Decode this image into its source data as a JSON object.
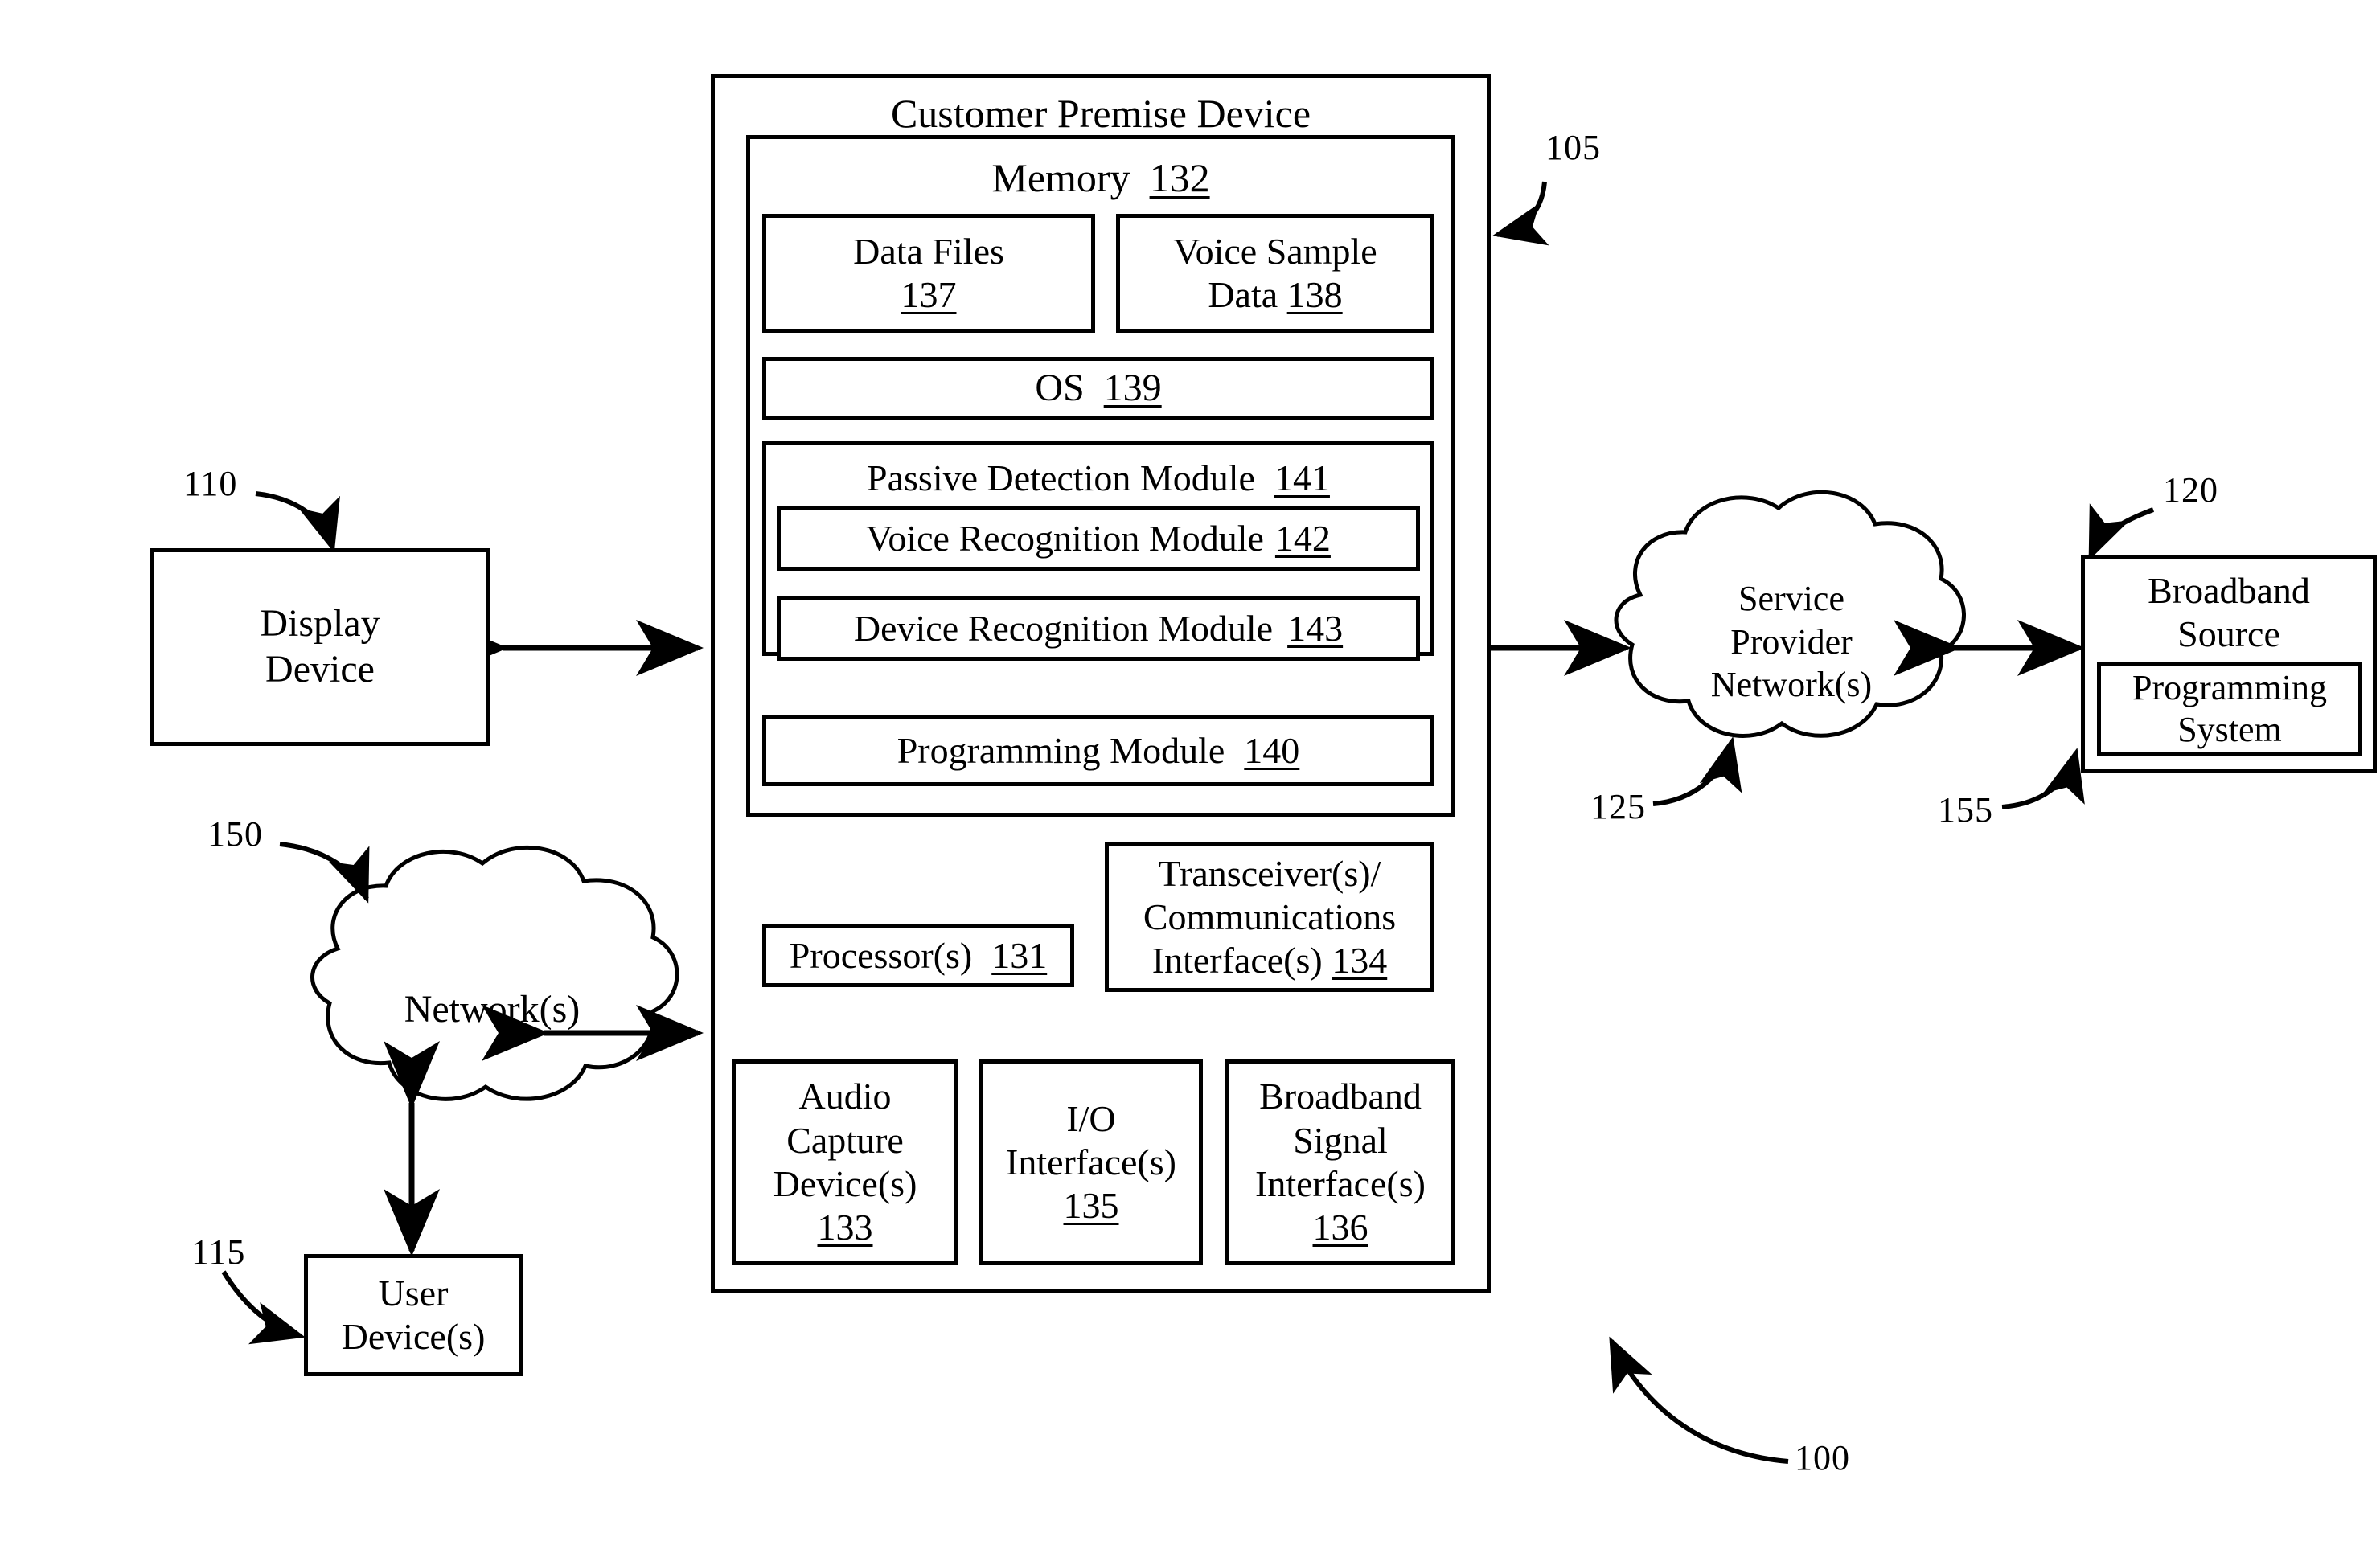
{
  "figure": {
    "system_ref": "100",
    "cpe_ref": "105"
  },
  "cpe": {
    "title": "Customer Premise Device",
    "memory": {
      "label": "Memory",
      "ref": "132",
      "data_files": {
        "label": "Data Files",
        "ref": "137"
      },
      "voice_sample": {
        "label_line1": "Voice Sample",
        "label_line2": "Data",
        "ref": "138"
      },
      "os": {
        "label": "OS",
        "ref": "139"
      },
      "passive_detection": {
        "label": "Passive Detection Module",
        "ref": "141"
      },
      "voice_recognition": {
        "label": "Voice Recognition Module",
        "ref": "142"
      },
      "device_recognition": {
        "label": "Device Recognition Module",
        "ref": "143"
      },
      "programming_module": {
        "label": "Programming Module",
        "ref": "140"
      }
    },
    "processor": {
      "label": "Processor(s)",
      "ref": "131"
    },
    "transceiver": {
      "line1": "Transceiver(s)/",
      "line2": "Communications",
      "line3": "Interface(s)",
      "ref": "134"
    },
    "audio_capture": {
      "line1": "Audio",
      "line2": "Capture",
      "line3": "Device(s)",
      "ref": "133"
    },
    "io_interface": {
      "line1": "I/O",
      "line2": "Interface(s)",
      "ref": "135"
    },
    "broadband_signal_interface": {
      "line1": "Broadband",
      "line2": "Signal",
      "line3": "Interface(s)",
      "ref": "136"
    }
  },
  "display_device": {
    "line1": "Display",
    "line2": "Device",
    "ref": "110"
  },
  "networks_cloud": {
    "label": "Network(s)",
    "ref": "150"
  },
  "user_device": {
    "line1": "User",
    "line2": "Device(s)",
    "ref": "115"
  },
  "service_provider_cloud": {
    "line1": "Service",
    "line2": "Provider",
    "line3": "Network(s)",
    "ref": "125"
  },
  "broadband_source": {
    "line1": "Broadband",
    "line2": "Source",
    "ref": "120",
    "programming_system": {
      "line1": "Programming",
      "line2": "System",
      "ref": "155"
    }
  },
  "colors": {
    "line": "#000000",
    "background": "#ffffff"
  }
}
